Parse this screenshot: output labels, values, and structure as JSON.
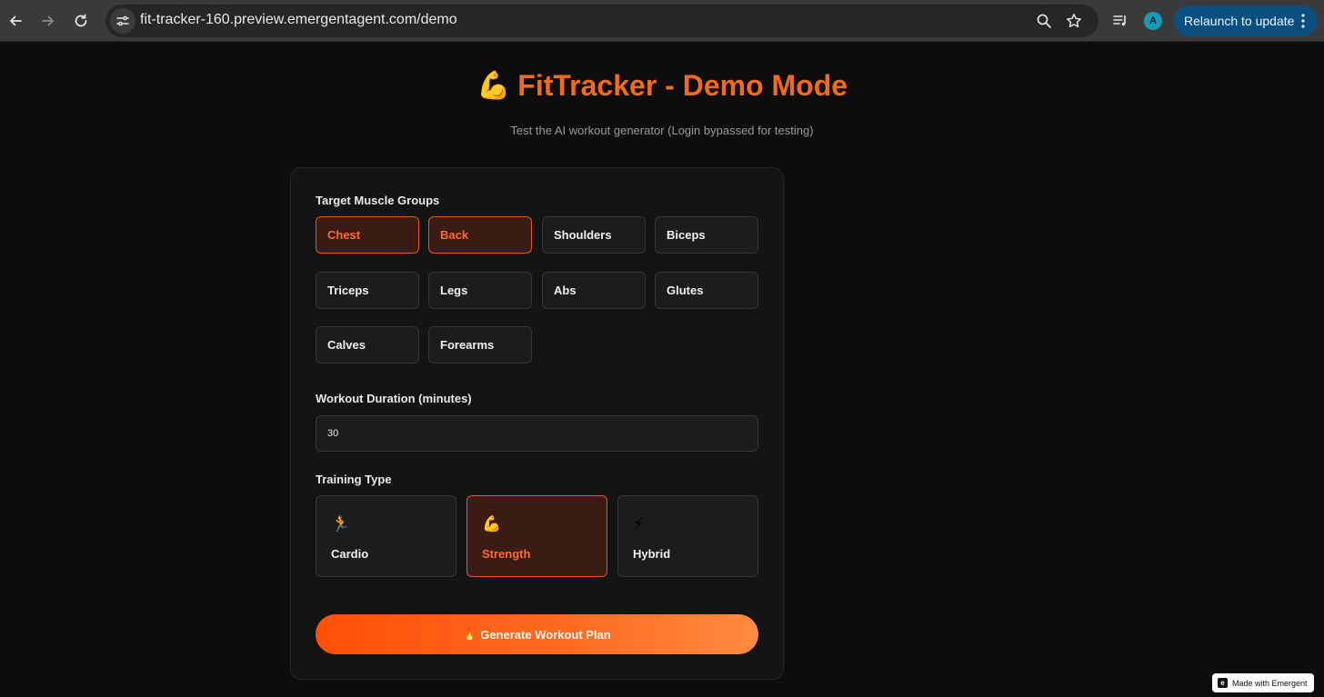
{
  "browser": {
    "url": "fit-tracker-160.preview.emergentagent.com/demo",
    "profile_initial": "A",
    "relaunch_label": "Relaunch to update"
  },
  "page": {
    "title_emoji": "💪",
    "title": "FitTracker - Demo Mode",
    "subtitle": "Test the AI workout generator (Login bypassed for testing)"
  },
  "form": {
    "muscle_groups_label": "Target Muscle Groups",
    "muscle_groups": [
      {
        "label": "Chest",
        "selected": true
      },
      {
        "label": "Back",
        "selected": true
      },
      {
        "label": "Shoulders",
        "selected": false
      },
      {
        "label": "Biceps",
        "selected": false
      },
      {
        "label": "Triceps",
        "selected": false
      },
      {
        "label": "Legs",
        "selected": false
      },
      {
        "label": "Abs",
        "selected": false
      },
      {
        "label": "Glutes",
        "selected": false
      },
      {
        "label": "Calves",
        "selected": false
      },
      {
        "label": "Forearms",
        "selected": false
      }
    ],
    "duration_label": "Workout Duration (minutes)",
    "duration_value": "30",
    "training_type_label": "Training Type",
    "training_types": [
      {
        "icon": "🏃",
        "icon_name": "runner-icon",
        "label": "Cardio",
        "selected": false
      },
      {
        "icon": "💪",
        "icon_name": "flexed-biceps-icon",
        "label": "Strength",
        "selected": true
      },
      {
        "icon": "⚡",
        "icon_name": "lightning-icon",
        "label": "Hybrid",
        "selected": false
      }
    ],
    "generate_icon": "🔥",
    "generate_label": "Generate Workout Plan"
  },
  "footer_badge": {
    "label": "Made with Emergent"
  },
  "colors": {
    "accent": "#f26b1d",
    "selected_bg": "#3a1c15",
    "selected_border": "#e8551c",
    "page_bg": "#0d0d0d",
    "card_bg": "#141414"
  }
}
